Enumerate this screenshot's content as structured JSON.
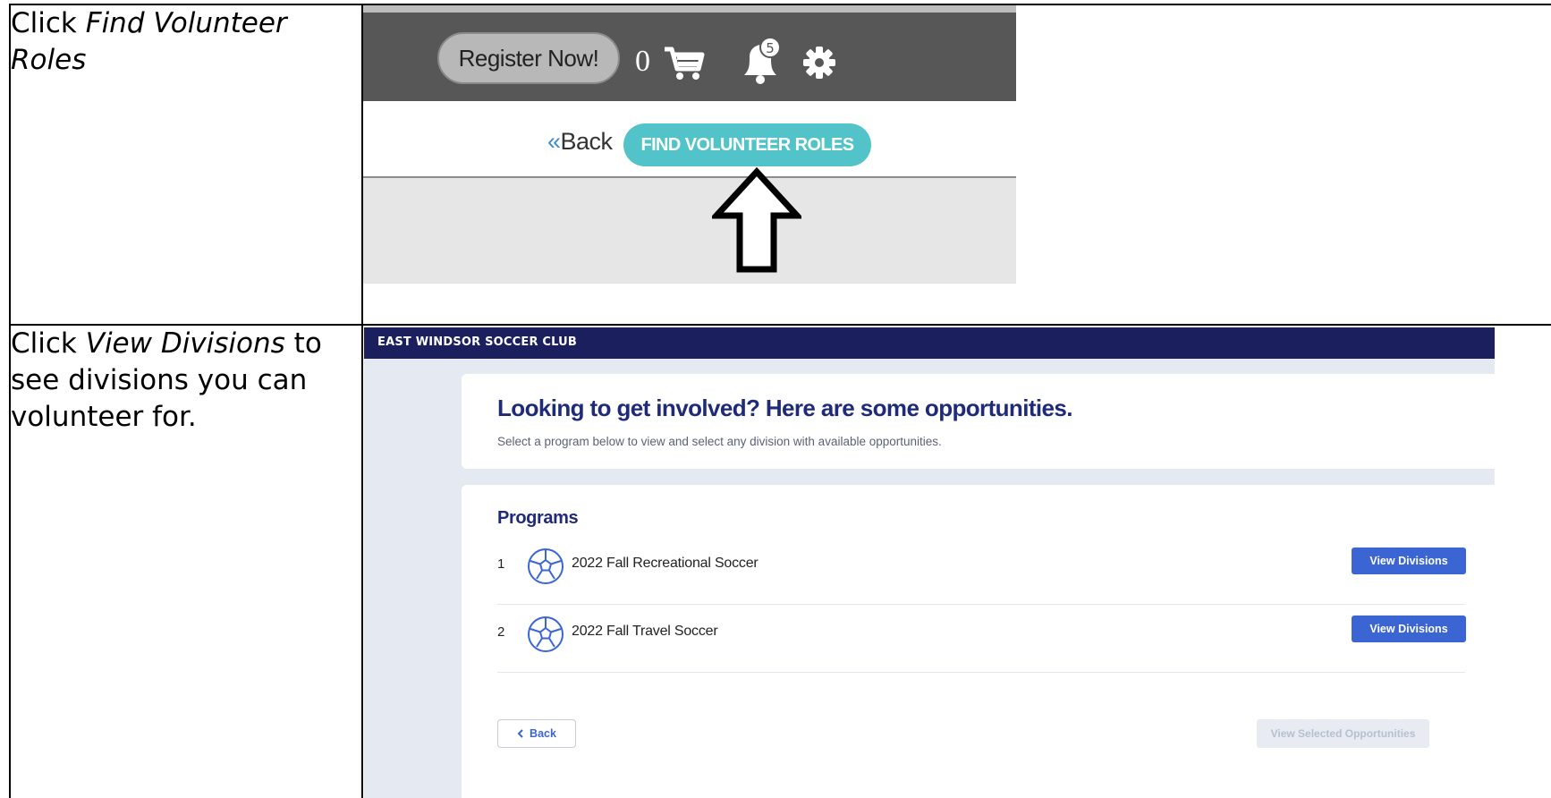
{
  "rows": [
    {
      "instruction_prefix": "Click ",
      "instruction_emphasis": "Find Volunteer Roles",
      "instruction_suffix": ""
    },
    {
      "instruction_prefix": "Click ",
      "instruction_emphasis": "View Divisions",
      "instruction_suffix": " to see divisions you can volunteer for."
    }
  ],
  "shot1": {
    "register_label": "Register Now!",
    "cart_count": "0",
    "notification_count": "5",
    "back_chevron": "«",
    "back_label": "Back",
    "find_label": "FIND VOLUNTEER ROLES",
    "icons": [
      "shopping-cart-icon",
      "bell-icon",
      "gear-icon",
      "up-arrow-icon"
    ],
    "colors": {
      "topbar": "#575757",
      "find_button": "#52c3c8",
      "register_button": "#b8b8b8"
    }
  },
  "shot2": {
    "club_name": "EAST WINDSOR SOCCER CLUB",
    "headline": "Looking to get involved? Here are some opportunities.",
    "subline": "Select a program below to view and select any division with available opportunities.",
    "programs_title": "Programs",
    "programs": [
      {
        "number": "1",
        "name": "2022 Fall Recreational Soccer",
        "button": "View Divisions"
      },
      {
        "number": "2",
        "name": "2022 Fall Travel Soccer",
        "button": "View Divisions"
      }
    ],
    "back_label": "Back",
    "view_selected_label": "View Selected Opportunities",
    "icons": [
      "soccer-ball-icon",
      "chevron-left-icon"
    ],
    "colors": {
      "club_bar": "#1b1f5e",
      "primary_button": "#3a65d3",
      "heading": "#1f2b78"
    }
  }
}
